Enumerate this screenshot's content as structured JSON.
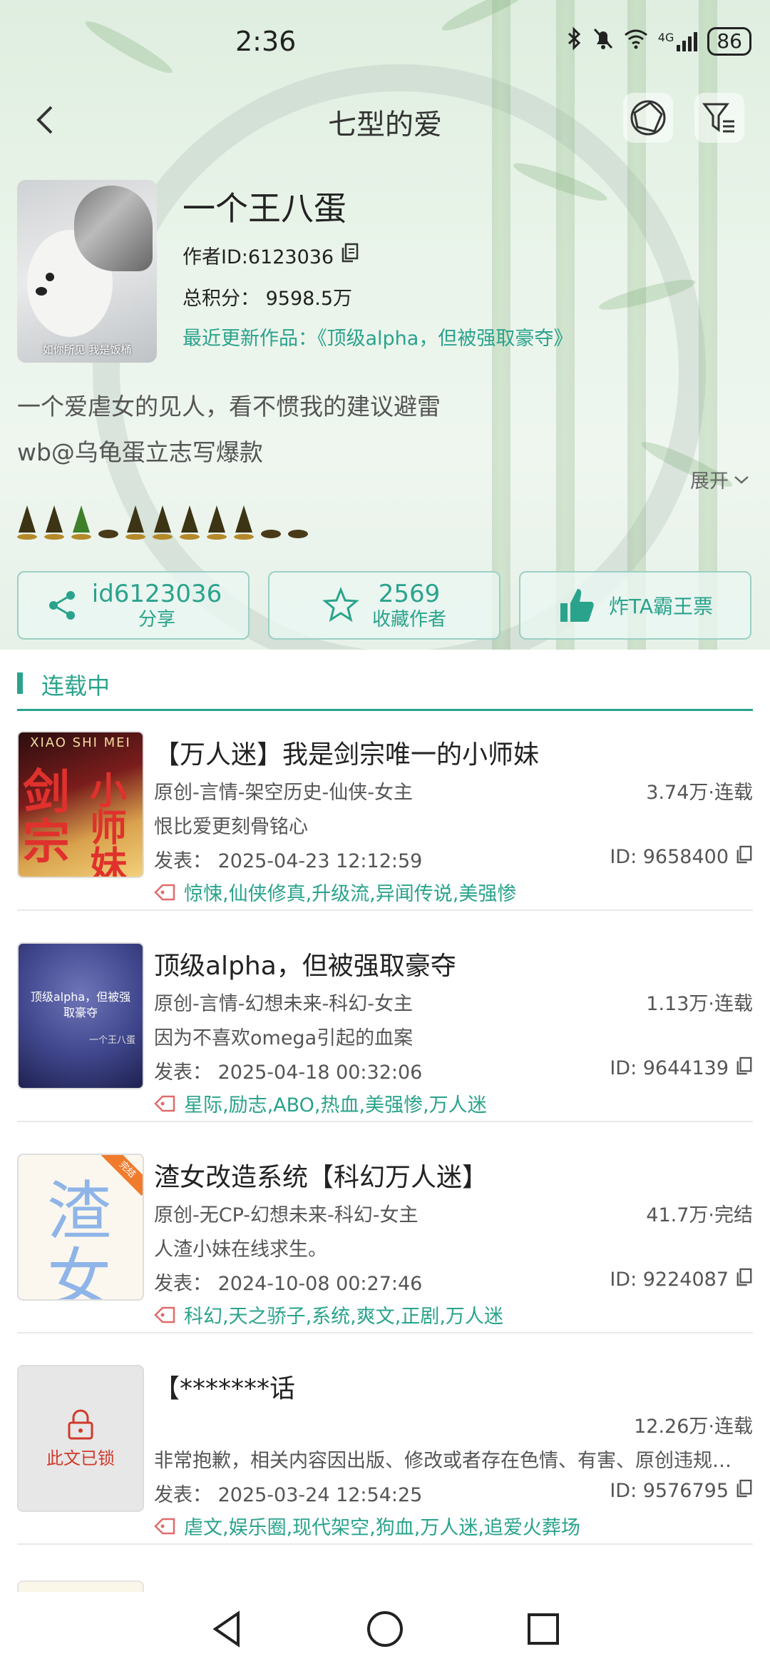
{
  "status": {
    "time": "2:36",
    "battery": "86",
    "network": "4G"
  },
  "nav": {
    "title": "七型的爱"
  },
  "author": {
    "avatar_caption": "如你所见 我是饭桶",
    "name": "一个王八蛋",
    "id_text": "作者ID:6123036",
    "score_text": "总积分：  9598.5万",
    "recent_text": "最近更新作品：《顶级alpha，但被强取豪夺》",
    "bio_lines": [
      "一个爱虐女的见人，看不惯我的建议避雷",
      "wb@乌龟蛋立志写爆款"
    ],
    "expand_label": "展开"
  },
  "actions": {
    "share": {
      "value": "id6123036",
      "label": "分享"
    },
    "favorite": {
      "value": "2569",
      "label": "收藏作者"
    },
    "bomb": {
      "label": "炸TA霸王票"
    }
  },
  "section": {
    "label": "连载中"
  },
  "books": [
    {
      "title": "【万人迷】我是剑宗唯一的小师妹",
      "meta": "原创-言情-架空历史-仙侠-女主",
      "stat": "3.74万·连载",
      "desc": "恨比爱更刻骨铭心",
      "date": "发表：  2025-04-23 12:12:59",
      "id": "ID: 9658400",
      "tags": "惊悚,仙侠修真,升级流,异闻传说,美强惨",
      "cover_chars": [
        "剑",
        "宗",
        "小",
        "师",
        "妹"
      ],
      "cover_top": "XIAO SHI MEI"
    },
    {
      "title": "顶级alpha，但被强取豪夺",
      "meta": "原创-言情-幻想未来-科幻-女主",
      "stat": "1.13万·连载",
      "desc": "因为不喜欢omega引起的血案",
      "date": "发表：  2025-04-18 00:32:06",
      "id": "ID: 9644139",
      "tags": "星际,励志,ABO,热血,美强惨,万人迷",
      "cover_text": "顶级alpha，但被强取豪夺",
      "cover_author": "一个王八蛋"
    },
    {
      "title": "渣女改造系统【科幻万人迷】",
      "meta": "原创-无CP-幻想未来-科幻-女主",
      "stat": "41.7万·完结",
      "desc": "人渣小妹在线求生。",
      "date": "发表：  2024-10-08 00:27:46",
      "id": "ID: 9224087",
      "tags": "科幻,天之骄子,系统,爽文,正剧,万人迷",
      "cover_chars": [
        "渣",
        "女"
      ],
      "cover_ribbon": "完结"
    },
    {
      "title": "【*******话",
      "meta": "",
      "stat": "12.26万·连载",
      "desc": "非常抱歉，相关内容因出版、修改或者存在色情、有害、原创违规…",
      "date": "发表：  2025-03-24 12:54:25",
      "id": "ID: 9576795",
      "tags": "虐文,娱乐圈,现代架空,狗血,万人迷,追爱火葬场",
      "cover_lock_label": "此文已锁"
    }
  ],
  "colors": {
    "accent": "#2aa38c",
    "lock_red": "#d03a2b"
  }
}
